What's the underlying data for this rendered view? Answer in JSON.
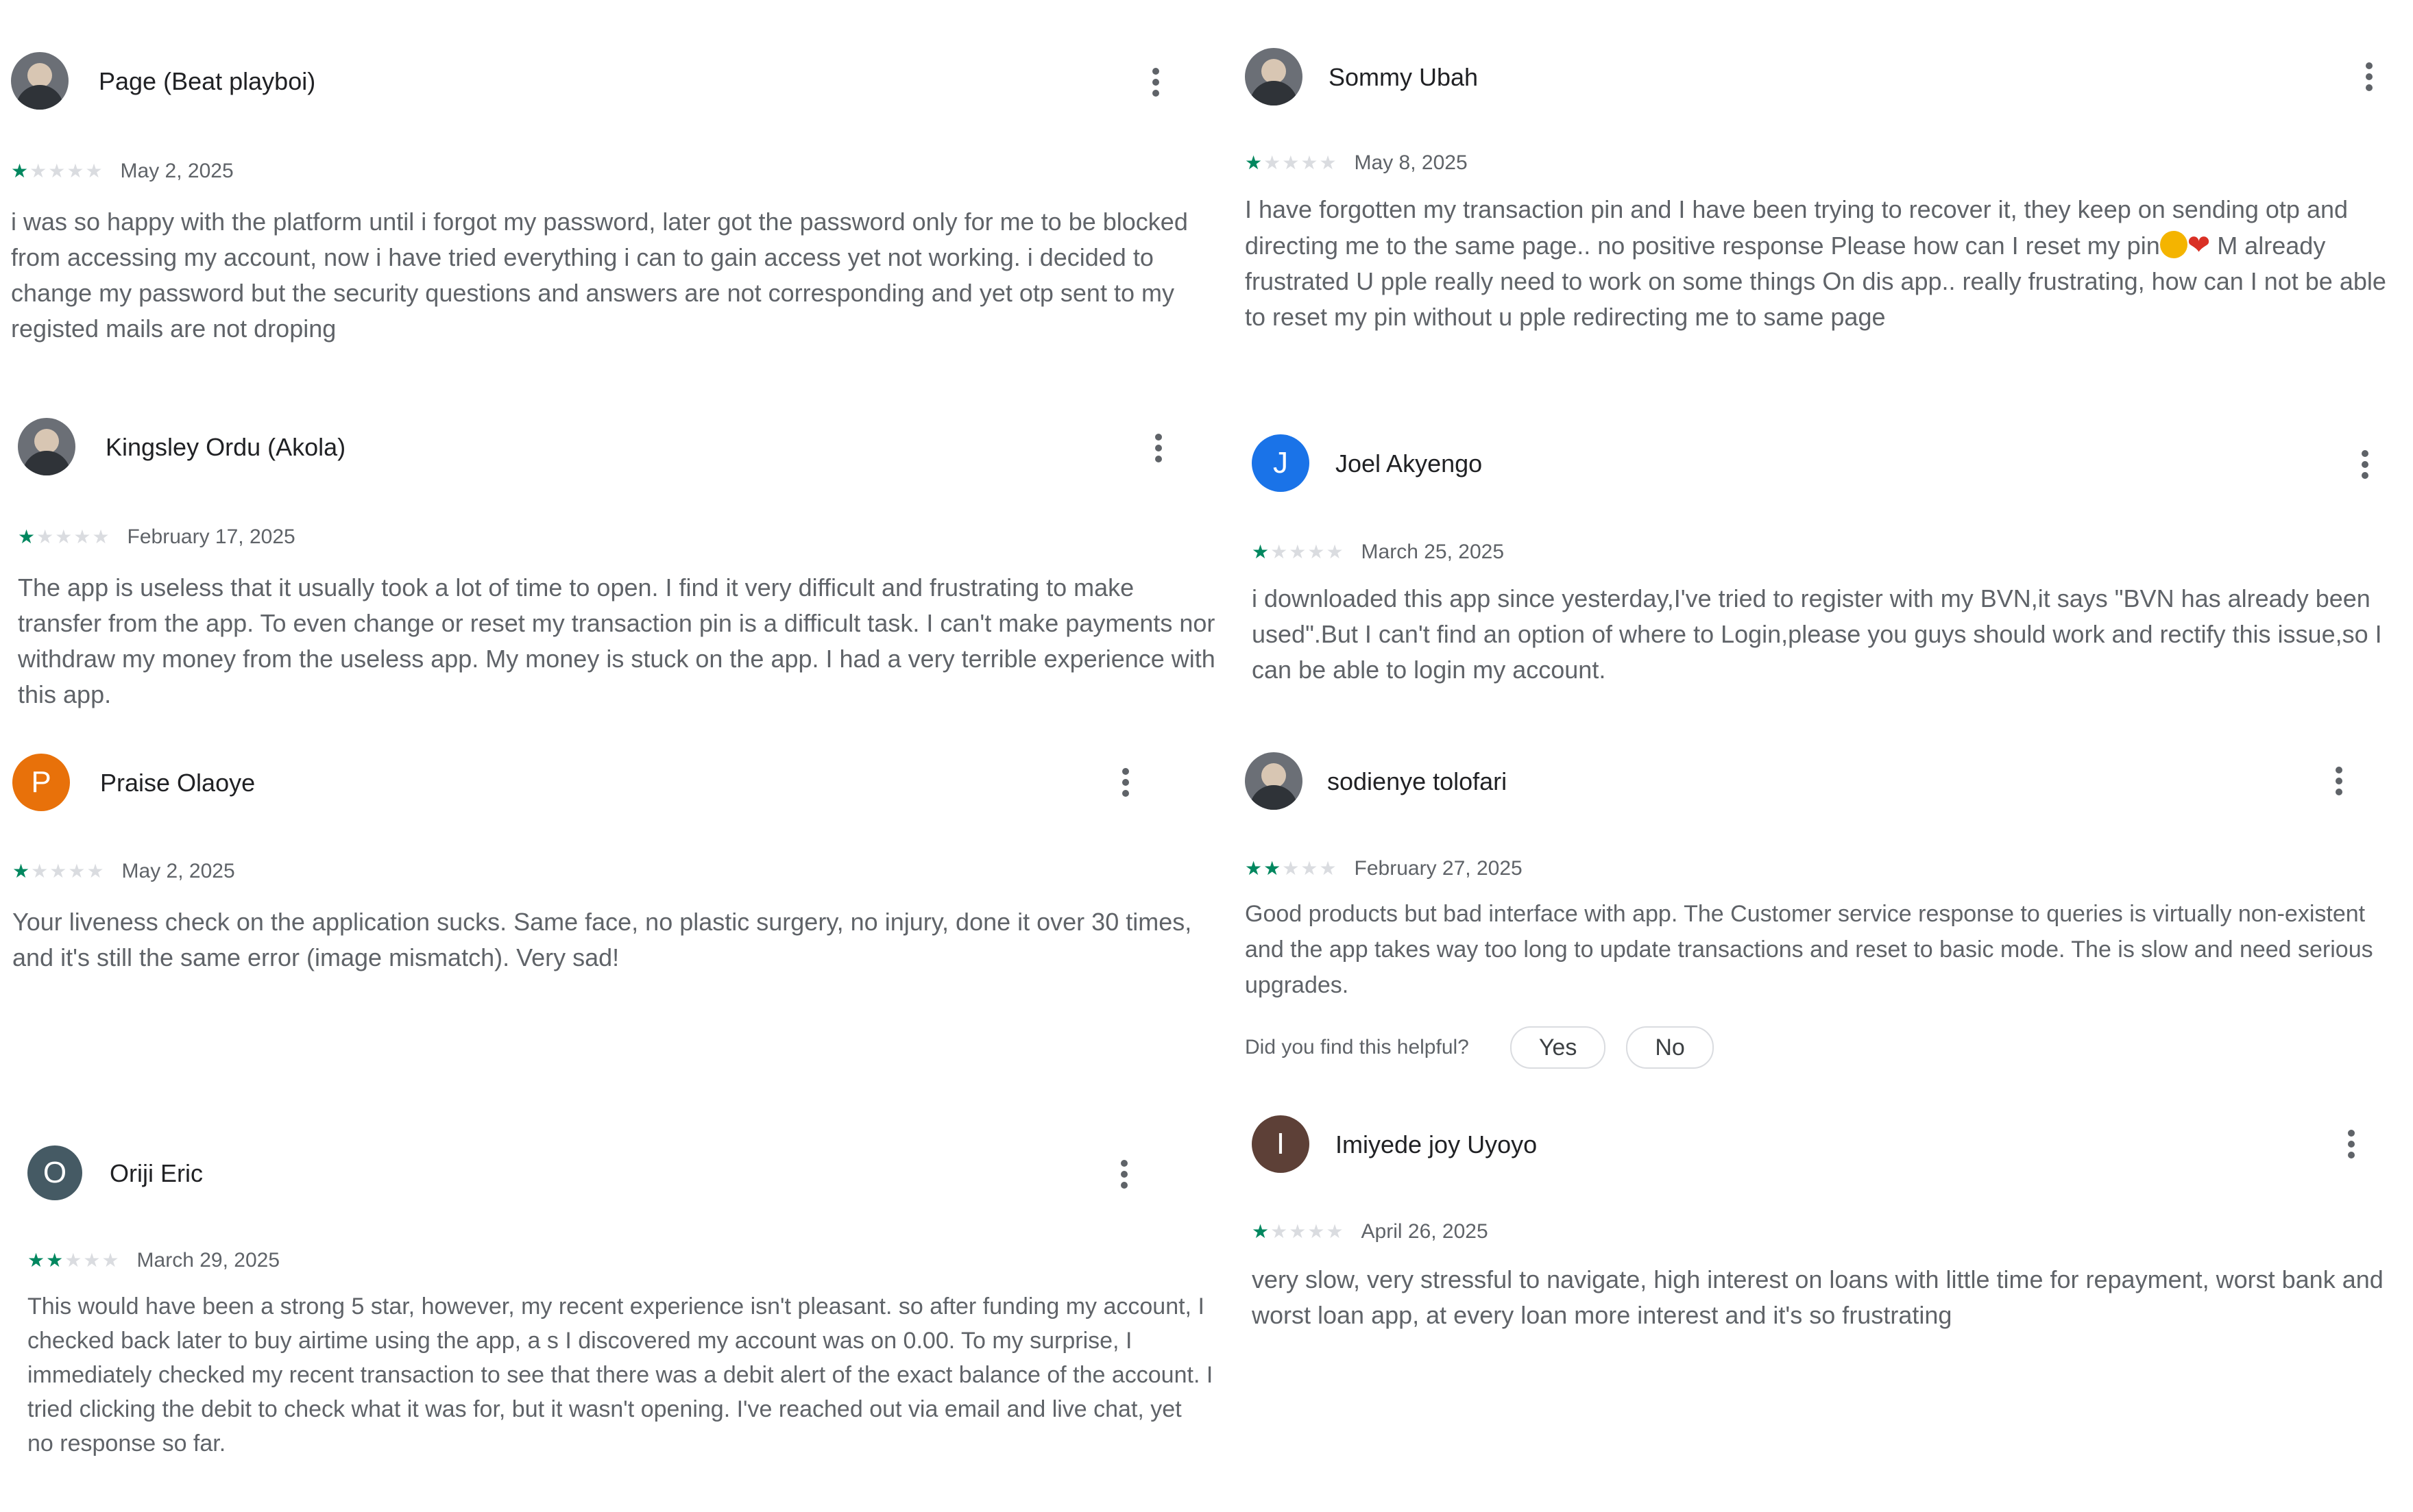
{
  "reviews": [
    {
      "name": "Page (Beat playboi)",
      "avatar_type": "photo",
      "stars": 1,
      "date": "May 2, 2025",
      "text": "i was so happy with the platform until i forgot my password, later got the password only for me to be blocked from accessing my account, now i have tried everything i can to gain access yet not working. i decided to change my password but the security questions and answers are not corresponding and yet otp sent to my registed mails are not droping"
    },
    {
      "name": "Kingsley Ordu (Akola)",
      "avatar_type": "photo",
      "stars": 1,
      "date": "February 17, 2025",
      "text": "The app is useless that it usually took a lot of time to open. I find it very difficult and frustrating to make transfer from the app. To even change or reset my transaction pin is a difficult task. I can't make payments nor withdraw my money from the useless app. My money is stuck on the app. I had a very terrible experience with this app."
    },
    {
      "name": "Praise Olaoye",
      "avatar_letter": "P",
      "avatar_color": "#e8710a",
      "stars": 1,
      "date": "May 2, 2025",
      "text": "Your liveness check on the application sucks. Same face, no plastic surgery, no injury, done it over 30 times, and it's still the same error (image mismatch). Very sad!"
    },
    {
      "name": "Oriji Eric",
      "avatar_letter": "O",
      "avatar_color": "#455a64",
      "stars": 2,
      "date": "March 29, 2025",
      "text": "This would have been a strong 5 star, however, my recent experience isn't pleasant. so after funding my account, I checked back later to buy airtime using the app, a s I discovered my account was on 0.00. To my surprise, I immediately checked my recent transaction to see that there was a debit alert of the exact balance of the account. I tried clicking the debit to check what it was for, but it wasn't opening. I've reached out via email and live chat, yet no response so far."
    },
    {
      "name": "Sommy Ubah",
      "avatar_type": "photo",
      "stars": 1,
      "date": "May 8, 2025",
      "text_before_emoji": "I have forgotten my transaction pin and I have been trying to recover it, they keep on sending otp and directing me to the same page.. no positive response Please how can I reset my pin",
      "text_after_emoji": " M already frustrated U pple really need to work on some things On dis app.. really frustrating, how can I not be able to reset my pin without u pple redirecting me to same page"
    },
    {
      "name": "Joel Akyengo",
      "avatar_letter": "J",
      "avatar_color": "#1a73e8",
      "stars": 1,
      "date": "March 25, 2025",
      "text": "i downloaded this app since yesterday,I've tried to register with my BVN,it says \"BVN has already been used\".But I can't find an option of where to Login,please you guys should work and rectify this issue,so I can be able to login my account."
    },
    {
      "name": "sodienye tolofari",
      "avatar_type": "photo",
      "stars": 2,
      "date": "February 27, 2025",
      "text": "Good products but bad interface with app. The Customer service response to queries is virtually non-existent and the app takes way too long to update transactions and reset to basic mode. The is slow and need serious upgrades.",
      "helpful": {
        "question": "Did you find this helpful?",
        "yes": "Yes",
        "no": "No"
      }
    },
    {
      "name": "Imiyede joy Uyoyo",
      "avatar_letter": "I",
      "avatar_color": "#5d4037",
      "stars": 1,
      "date": "April 26, 2025",
      "text": "very slow, very stressful to navigate, high interest on loans with little time for repayment, worst bank and worst loan app, at every loan more interest and it's so frustrating"
    }
  ],
  "colors": {
    "star_on": "#01875f",
    "star_off": "#dadce0",
    "text": "#5f6368",
    "name": "#202124"
  },
  "icons": {
    "more": "more-vert-icon",
    "star": "star-icon"
  }
}
